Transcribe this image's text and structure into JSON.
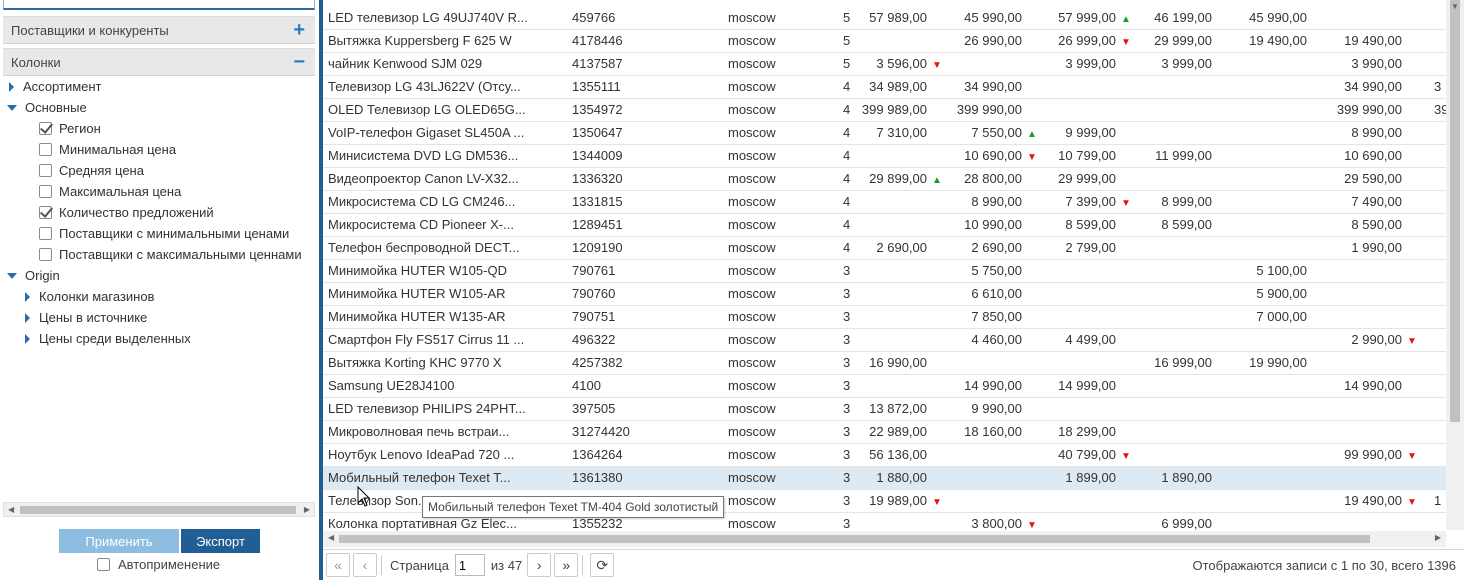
{
  "left_panel": {
    "sections": {
      "suppliers": {
        "label": "Поставщики и конкуренты",
        "button": "+"
      },
      "columns": {
        "label": "Колонки",
        "button": "−"
      }
    },
    "tree": [
      {
        "label": "Ассортимент",
        "kind": "collapsed",
        "level": 0
      },
      {
        "label": "Основные",
        "kind": "expanded",
        "level": 0
      },
      {
        "label": "Регион",
        "kind": "check",
        "checked": true,
        "level": 1
      },
      {
        "label": "Минимальная цена",
        "kind": "check",
        "checked": false,
        "level": 1
      },
      {
        "label": "Средняя цена",
        "kind": "check",
        "checked": false,
        "level": 1
      },
      {
        "label": "Максимальная цена",
        "kind": "check",
        "checked": false,
        "level": 1
      },
      {
        "label": "Количество предложений",
        "kind": "check",
        "checked": true,
        "level": 1
      },
      {
        "label": "Поставщики с минимальными ценами",
        "kind": "check",
        "checked": false,
        "level": 1
      },
      {
        "label": "Поставщики с максимальными ценнами",
        "kind": "check",
        "checked": false,
        "level": 1
      },
      {
        "label": "Origin",
        "kind": "expanded",
        "level": 0
      },
      {
        "label": "Колонки магазинов",
        "kind": "collapsed",
        "level": 1
      },
      {
        "label": "Цены в источнике",
        "kind": "collapsed",
        "level": 1
      },
      {
        "label": "Цены среди выделенных",
        "kind": "collapsed",
        "level": 1
      }
    ],
    "apply_label": "Применить",
    "export_label": "Экспорт",
    "autoapply_label": "Автоприменение"
  },
  "grid": {
    "rows": [
      {
        "name": "LED телевизор LG 49UJ740V R...",
        "code": "459766",
        "region": "moscow",
        "count": "5",
        "v": [
          [
            "57 989,00",
            ""
          ],
          [
            "45 990,00",
            ""
          ],
          [
            "57 999,00",
            "up"
          ],
          [
            "46 199,00",
            ""
          ],
          [
            "45 990,00",
            ""
          ],
          [
            "",
            ""
          ],
          [
            "",
            ""
          ]
        ]
      },
      {
        "name": "Вытяжка Kuppersberg F 625 W",
        "code": "4178446",
        "region": "moscow",
        "count": "5",
        "v": [
          [
            "",
            ""
          ],
          [
            "26 990,00",
            ""
          ],
          [
            "26 999,00",
            "down"
          ],
          [
            "29 999,00",
            ""
          ],
          [
            "19 490,00",
            ""
          ],
          [
            "19 490,00",
            ""
          ],
          [
            "",
            ""
          ]
        ]
      },
      {
        "name": "чайник Kenwood SJM 029",
        "code": "4137587",
        "region": "moscow",
        "count": "5",
        "v": [
          [
            "3 596,00",
            "down"
          ],
          [
            "",
            ""
          ],
          [
            "3 999,00",
            ""
          ],
          [
            "3 999,00",
            ""
          ],
          [
            "",
            ""
          ],
          [
            "3 990,00",
            ""
          ],
          [
            "",
            ""
          ]
        ]
      },
      {
        "name": "Телевизор LG 43LJ622V (Отсу...",
        "code": "1355111",
        "region": "moscow",
        "count": "4",
        "v": [
          [
            "34 989,00",
            ""
          ],
          [
            "34 990,00",
            ""
          ],
          [
            "",
            ""
          ],
          [
            "",
            ""
          ],
          [
            "",
            ""
          ],
          [
            "34 990,00",
            ""
          ],
          [
            "3",
            ""
          ]
        ]
      },
      {
        "name": "OLED Телевизор LG OLED65G...",
        "code": "1354972",
        "region": "moscow",
        "count": "4",
        "v": [
          [
            "399 989,00",
            ""
          ],
          [
            "399 990,00",
            ""
          ],
          [
            "",
            ""
          ],
          [
            "",
            ""
          ],
          [
            "",
            ""
          ],
          [
            "399 990,00",
            ""
          ],
          [
            "39",
            ""
          ]
        ]
      },
      {
        "name": "VoIP-телефон Gigaset SL450A ...",
        "code": "1350647",
        "region": "moscow",
        "count": "4",
        "v": [
          [
            "7 310,00",
            ""
          ],
          [
            "7 550,00",
            "up"
          ],
          [
            "9 999,00",
            ""
          ],
          [
            "",
            ""
          ],
          [
            "",
            ""
          ],
          [
            "8 990,00",
            ""
          ],
          [
            "",
            ""
          ]
        ]
      },
      {
        "name": "Минисистема DVD LG DM536...",
        "code": "1344009",
        "region": "moscow",
        "count": "4",
        "v": [
          [
            "",
            ""
          ],
          [
            "10 690,00",
            "down"
          ],
          [
            "10 799,00",
            ""
          ],
          [
            "11 999,00",
            ""
          ],
          [
            "",
            ""
          ],
          [
            "10 690,00",
            ""
          ],
          [
            "",
            ""
          ]
        ]
      },
      {
        "name": "Видеопроектор Canon LV-X32...",
        "code": "1336320",
        "region": "moscow",
        "count": "4",
        "v": [
          [
            "29 899,00",
            "up"
          ],
          [
            "28 800,00",
            ""
          ],
          [
            "29 999,00",
            ""
          ],
          [
            "",
            ""
          ],
          [
            "",
            ""
          ],
          [
            "29 590,00",
            ""
          ],
          [
            "",
            ""
          ]
        ]
      },
      {
        "name": "Микросистема CD LG CM246...",
        "code": "1331815",
        "region": "moscow",
        "count": "4",
        "v": [
          [
            "",
            ""
          ],
          [
            "8 990,00",
            ""
          ],
          [
            "7 399,00",
            "down"
          ],
          [
            "8 999,00",
            ""
          ],
          [
            "",
            ""
          ],
          [
            "7 490,00",
            ""
          ],
          [
            "",
            ""
          ]
        ]
      },
      {
        "name": "Микросистема CD Pioneer X-...",
        "code": "1289451",
        "region": "moscow",
        "count": "4",
        "v": [
          [
            "",
            ""
          ],
          [
            "10 990,00",
            ""
          ],
          [
            "8 599,00",
            ""
          ],
          [
            "8 599,00",
            ""
          ],
          [
            "",
            ""
          ],
          [
            "8 590,00",
            ""
          ],
          [
            "",
            ""
          ]
        ]
      },
      {
        "name": "Телефон беспроводной DECT...",
        "code": "1209190",
        "region": "moscow",
        "count": "4",
        "v": [
          [
            "2 690,00",
            ""
          ],
          [
            "2 690,00",
            ""
          ],
          [
            "2 799,00",
            ""
          ],
          [
            "",
            ""
          ],
          [
            "",
            ""
          ],
          [
            "1 990,00",
            ""
          ],
          [
            "",
            ""
          ]
        ]
      },
      {
        "name": "Минимойка HUTER W105-QD",
        "code": "790761",
        "region": "moscow",
        "count": "3",
        "v": [
          [
            "",
            ""
          ],
          [
            "5 750,00",
            ""
          ],
          [
            "",
            ""
          ],
          [
            "",
            ""
          ],
          [
            "5 100,00",
            ""
          ],
          [
            "",
            ""
          ],
          [
            "",
            ""
          ]
        ]
      },
      {
        "name": "Минимойка HUTER W105-AR",
        "code": "790760",
        "region": "moscow",
        "count": "3",
        "v": [
          [
            "",
            ""
          ],
          [
            "6 610,00",
            ""
          ],
          [
            "",
            ""
          ],
          [
            "",
            ""
          ],
          [
            "5 900,00",
            ""
          ],
          [
            "",
            ""
          ],
          [
            "",
            ""
          ]
        ]
      },
      {
        "name": "Минимойка HUTER W135-AR",
        "code": "790751",
        "region": "moscow",
        "count": "3",
        "v": [
          [
            "",
            ""
          ],
          [
            "7 850,00",
            ""
          ],
          [
            "",
            ""
          ],
          [
            "",
            ""
          ],
          [
            "7 000,00",
            ""
          ],
          [
            "",
            ""
          ],
          [
            "",
            ""
          ]
        ]
      },
      {
        "name": "Смартфон Fly FS517 Cirrus 11 ...",
        "code": "496322",
        "region": "moscow",
        "count": "3",
        "v": [
          [
            "",
            ""
          ],
          [
            "4 460,00",
            ""
          ],
          [
            "4 499,00",
            ""
          ],
          [
            "",
            ""
          ],
          [
            "",
            ""
          ],
          [
            "2 990,00",
            "down"
          ],
          [
            "",
            ""
          ]
        ]
      },
      {
        "name": "Вытяжка Korting KHC 9770 X",
        "code": "4257382",
        "region": "moscow",
        "count": "3",
        "v": [
          [
            "16 990,00",
            ""
          ],
          [
            "",
            ""
          ],
          [
            "",
            ""
          ],
          [
            "16 999,00",
            ""
          ],
          [
            "19 990,00",
            ""
          ],
          [
            "",
            ""
          ],
          [
            "",
            ""
          ]
        ]
      },
      {
        "name": "Samsung UE28J4100",
        "code": "4100",
        "region": "moscow",
        "count": "3",
        "v": [
          [
            "",
            ""
          ],
          [
            "14 990,00",
            ""
          ],
          [
            "14 999,00",
            ""
          ],
          [
            "",
            ""
          ],
          [
            "",
            ""
          ],
          [
            "14 990,00",
            ""
          ],
          [
            "",
            ""
          ]
        ]
      },
      {
        "name": "LED телевизор PHILIPS 24PHT...",
        "code": "397505",
        "region": "moscow",
        "count": "3",
        "v": [
          [
            "13 872,00",
            ""
          ],
          [
            "9 990,00",
            ""
          ],
          [
            "",
            ""
          ],
          [
            "",
            ""
          ],
          [
            "",
            ""
          ],
          [
            "",
            ""
          ],
          [
            "",
            ""
          ]
        ]
      },
      {
        "name": "Микроволновая печь встраи...",
        "code": "31274420",
        "region": "moscow",
        "count": "3",
        "v": [
          [
            "22 989,00",
            ""
          ],
          [
            "18 160,00",
            ""
          ],
          [
            "18 299,00",
            ""
          ],
          [
            "",
            ""
          ],
          [
            "",
            ""
          ],
          [
            "",
            ""
          ],
          [
            "",
            ""
          ]
        ]
      },
      {
        "name": "Ноутбук Lenovo IdeaPad 720 ...",
        "code": "1364264",
        "region": "moscow",
        "count": "3",
        "v": [
          [
            "56 136,00",
            ""
          ],
          [
            "",
            ""
          ],
          [
            "40 799,00",
            "down"
          ],
          [
            "",
            ""
          ],
          [
            "",
            ""
          ],
          [
            "99 990,00",
            "down"
          ],
          [
            "",
            ""
          ]
        ]
      },
      {
        "name": "Мобильный телефон Texet T...",
        "code": "1361380",
        "region": "moscow",
        "count": "3",
        "highlight": true,
        "v": [
          [
            "1 880,00",
            ""
          ],
          [
            "",
            ""
          ],
          [
            "1 899,00",
            ""
          ],
          [
            "1 890,00",
            ""
          ],
          [
            "",
            ""
          ],
          [
            "",
            ""
          ],
          [
            "",
            ""
          ]
        ]
      },
      {
        "name": "Телевизор Son...",
        "code": "...",
        "region": "moscow",
        "count": "3",
        "v": [
          [
            "19 989,00",
            "down"
          ],
          [
            "",
            ""
          ],
          [
            "",
            ""
          ],
          [
            "",
            ""
          ],
          [
            "",
            ""
          ],
          [
            "19 490,00",
            "down"
          ],
          [
            "1",
            ""
          ]
        ]
      },
      {
        "name": "Колонка портативная Gz Elec...",
        "code": "1355232",
        "region": "moscow",
        "count": "3",
        "v": [
          [
            "",
            ""
          ],
          [
            "3 800,00",
            "down"
          ],
          [
            "",
            ""
          ],
          [
            "6 999,00",
            ""
          ],
          [
            "",
            ""
          ],
          [
            "",
            ""
          ],
          [
            "",
            ""
          ]
        ]
      }
    ]
  },
  "tooltip": "Мобильный телефон Texet TM-404 Gold золотистый",
  "pager": {
    "page_label": "Страница",
    "page_value": "1",
    "page_of": "из 47",
    "records": "Отображаются записи с 1 по 30, всего 1396"
  },
  "colors": {
    "accent": "#1f5f94",
    "apply": "#8dbde0",
    "up": "#1b9a2e",
    "down": "#e3140f",
    "highlight_row": "#dde9f3"
  }
}
